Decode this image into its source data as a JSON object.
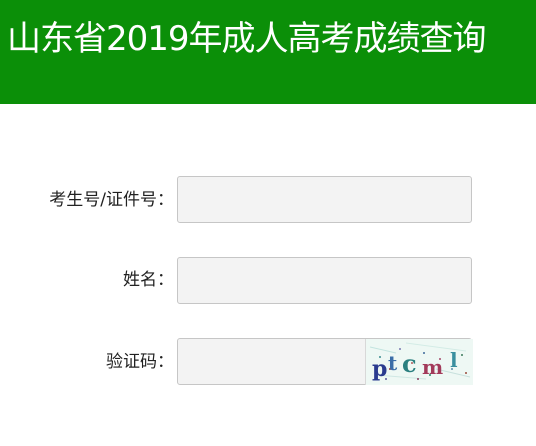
{
  "header": {
    "title": "山东省2019年成人高考成绩查询",
    "background": "#0b8f08"
  },
  "form": {
    "exam_id": {
      "label": "考生号/证件号：",
      "value": ""
    },
    "name": {
      "label": "姓名：",
      "value": ""
    },
    "captcha": {
      "label": "验证码：",
      "value": "",
      "image_text": "ptcml"
    }
  }
}
